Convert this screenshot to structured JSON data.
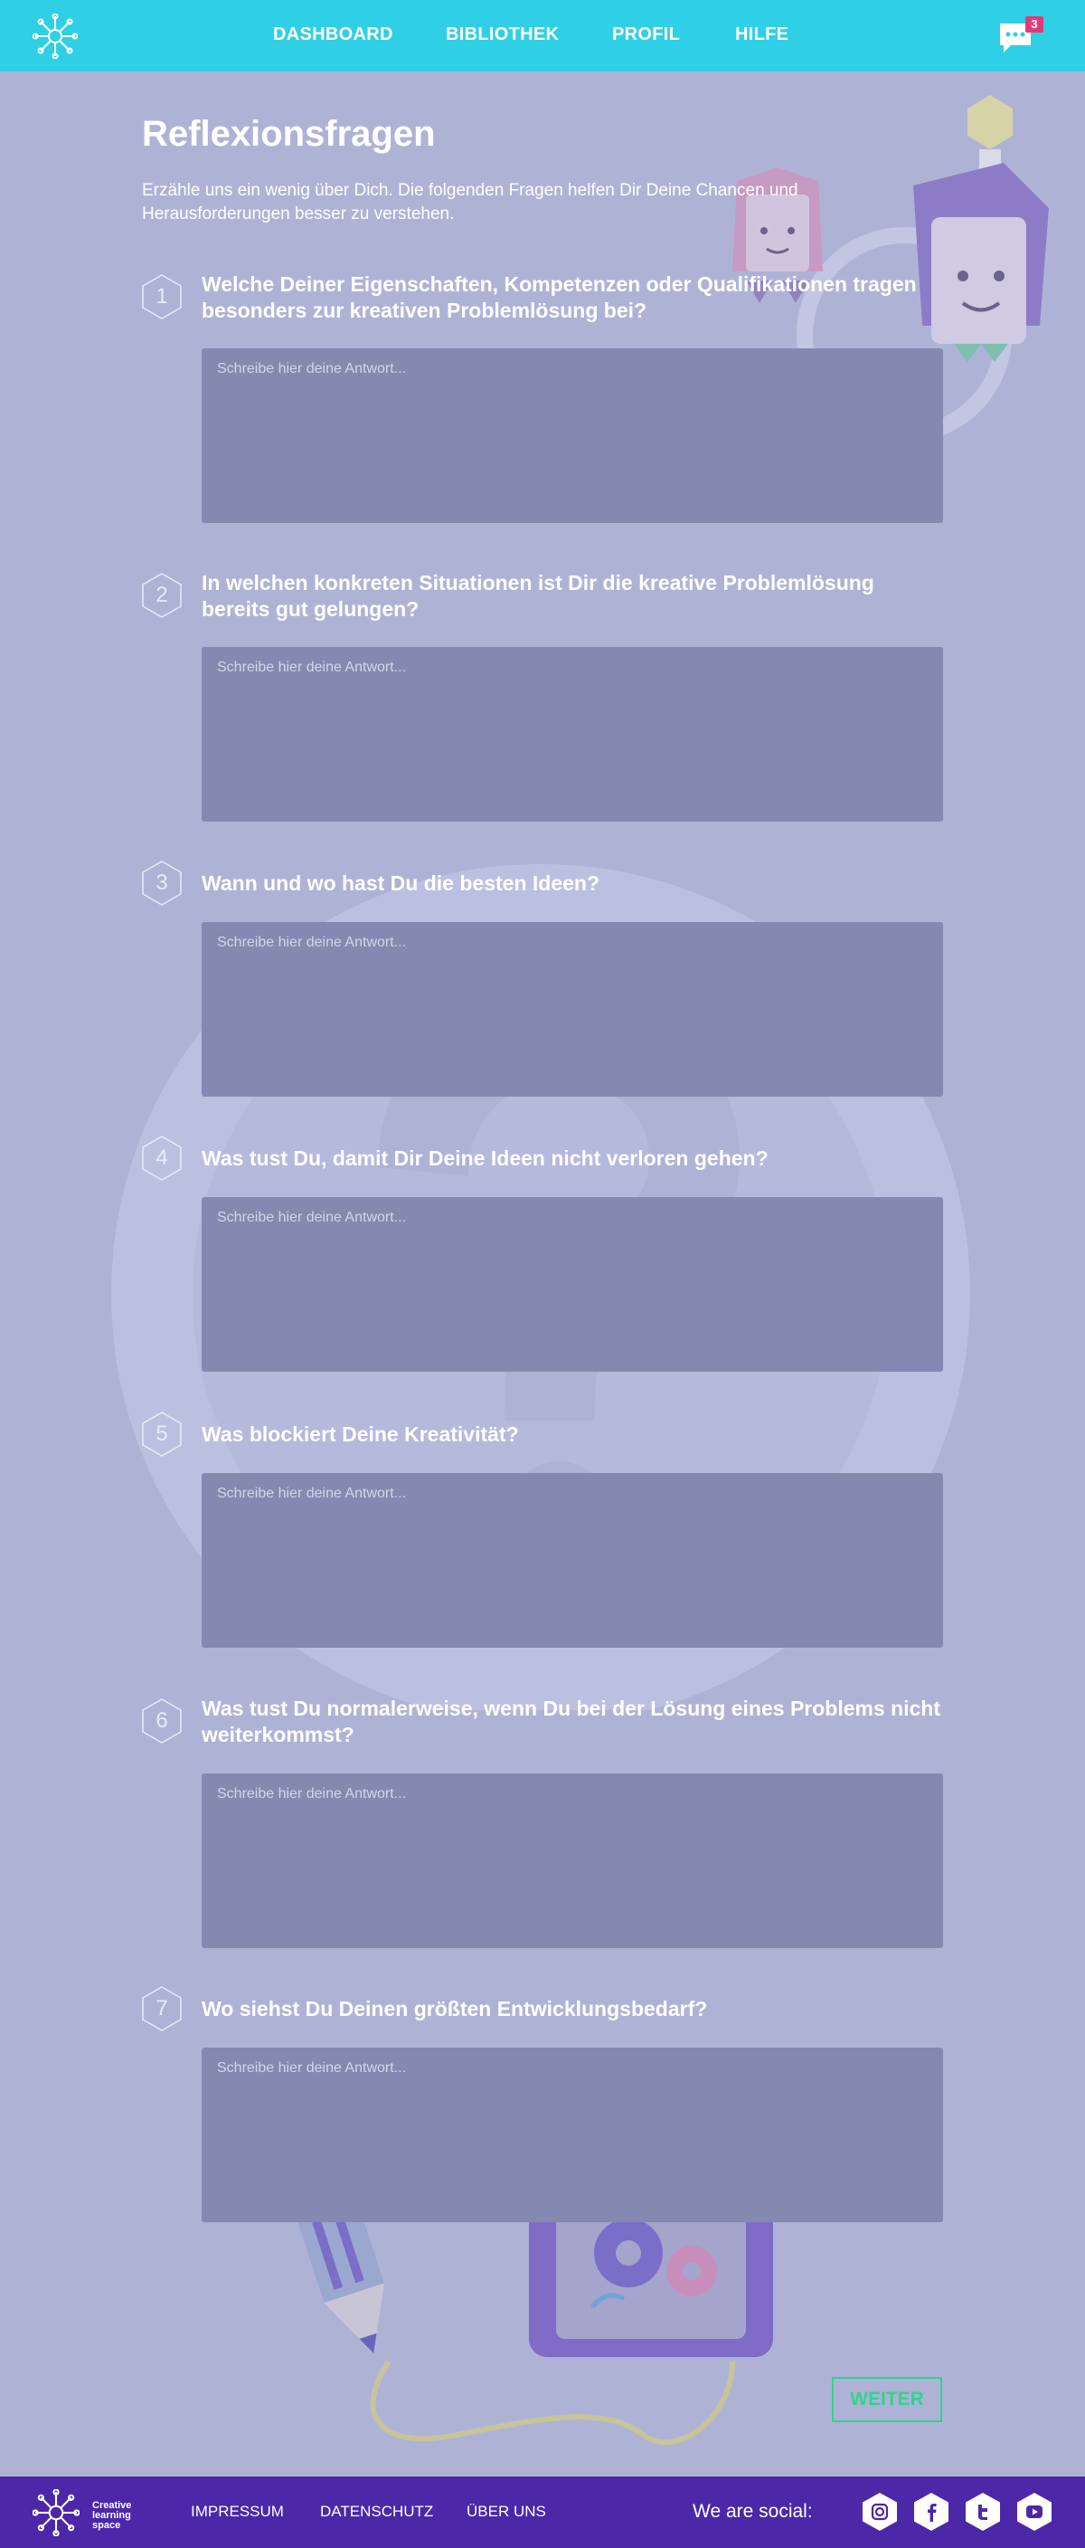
{
  "nav": {
    "items": [
      "DASHBOARD",
      "BIBLIOTHEK",
      "PROFIL",
      "HILFE"
    ],
    "chat_count": "3"
  },
  "page": {
    "title": "Reflexionsfragen",
    "intro": "Erzähle uns ein wenig über Dich. Die folgenden Fragen helfen Dir Deine Chancen und Herausforderungen besser zu verstehen."
  },
  "questions": [
    {
      "number": "1",
      "text": "Welche Deiner Eigenschaften, Kompetenzen oder Qualifikationen tragen besonders zur kreativen Problemlösung bei?",
      "placeholder": "Schreibe hier deine Antwort..."
    },
    {
      "number": "2",
      "text": "In welchen konkreten Situationen ist Dir die kreative Problemlösung bereits gut gelungen?",
      "placeholder": "Schreibe hier deine Antwort..."
    },
    {
      "number": "3",
      "text": "Wann und wo hast Du die besten Ideen?",
      "placeholder": "Schreibe hier deine Antwort..."
    },
    {
      "number": "4",
      "text": "Was tust Du, damit Dir Deine Ideen nicht verloren gehen?",
      "placeholder": "Schreibe hier deine Antwort..."
    },
    {
      "number": "5",
      "text": "Was blockiert Deine Kreativität?",
      "placeholder": "Schreibe hier deine Antwort..."
    },
    {
      "number": "6",
      "text": "Was tust Du normalerweise, wenn Du bei der Lösung eines Problems nicht weiterkommst?",
      "placeholder": "Schreibe hier deine Antwort..."
    },
    {
      "number": "7",
      "text": "Wo siehst Du Deinen größten Entwicklungsbedarf?",
      "placeholder": "Schreibe hier deine Antwort..."
    }
  ],
  "actions": {
    "next_label": "WEITER"
  },
  "footer": {
    "brand_lines": [
      "Creative",
      "learning",
      "space"
    ],
    "links": [
      "IMPRESSUM",
      "DATENSCHUTZ",
      "ÜBER UNS"
    ],
    "social_label": "We are social:",
    "social_icons": [
      "instagram-icon",
      "facebook-icon",
      "twitter-icon",
      "youtube-icon"
    ]
  },
  "colors": {
    "header": "#2fd0e6",
    "background": "#aeb3d6",
    "input_bg": "#8389b1",
    "accent_green": "#2ed58d",
    "footer": "#4c27a8",
    "badge": "#e23a78"
  }
}
